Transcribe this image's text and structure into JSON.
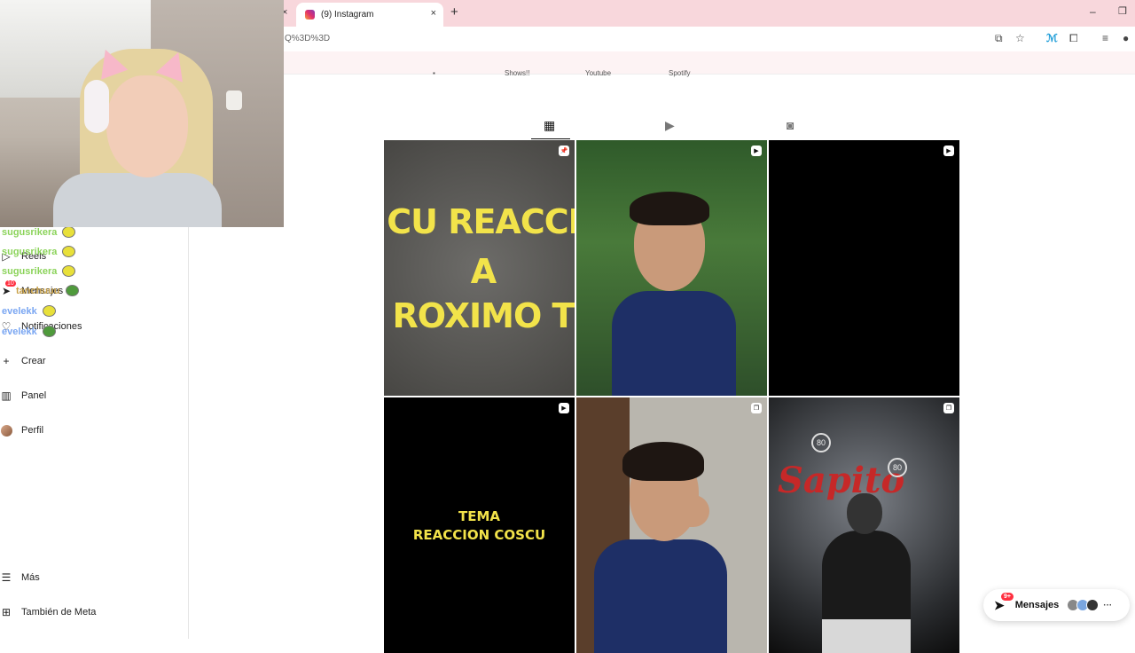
{
  "browser": {
    "tab_title": "(9) Instagram",
    "new_tab": "+",
    "tab_close": "×",
    "prev_tab_close": "×",
    "url_fragment": "Q%3D%3D",
    "minimize": "–",
    "restore": "❐"
  },
  "highlights_cut": [
    "Shows!!",
    "Youtube",
    "Spotify"
  ],
  "profile_tabs": [
    {
      "name": "posts",
      "icon": "grid-icon",
      "glyph": "▦",
      "active": true
    },
    {
      "name": "reels",
      "icon": "reels-icon",
      "glyph": "▶",
      "active": false
    },
    {
      "name": "tagged",
      "icon": "tagged-icon",
      "glyph": "◙",
      "active": false
    }
  ],
  "sidebar": {
    "items": [
      {
        "label": "Reels",
        "icon": "reels-icon"
      },
      {
        "label": "Mensajes",
        "icon": "messenger-icon"
      },
      {
        "label": "Notificaciones",
        "icon": "heart-icon"
      },
      {
        "label": "Crear",
        "icon": "plus-icon"
      },
      {
        "label": "Panel",
        "icon": "panel-icon"
      },
      {
        "label": "Perfil",
        "icon": "avatar"
      },
      {
        "label": "Más",
        "icon": "menu-icon"
      },
      {
        "label": "También de Meta",
        "icon": "meta-grid-icon"
      }
    ],
    "messages_badge": "10"
  },
  "chat": [
    {
      "user": "sugusrikera"
    },
    {
      "user": "sugusrikera"
    },
    {
      "user": "sugusrikera"
    },
    {
      "user": "tanchuuu"
    },
    {
      "user": "evelekk"
    },
    {
      "user": "evelekk"
    }
  ],
  "posts": [
    {
      "id": "p1",
      "text_lines": [
        "CU REACCI",
        "A",
        "ROXIMO T"
      ],
      "badge": "pin-icon"
    },
    {
      "id": "p2",
      "badge": "reel-icon"
    },
    {
      "id": "p3",
      "badge": "reel-icon"
    },
    {
      "id": "p4",
      "text_lines": [
        "TEMA",
        "REACCION COSCU"
      ],
      "badge": "reel-icon"
    },
    {
      "id": "p5",
      "badge": "carousel-icon"
    },
    {
      "id": "p6",
      "sign_text": "Sapito",
      "sign_numbers": [
        "80",
        "80"
      ],
      "badge": "carousel-icon"
    }
  ],
  "messages_pill": {
    "label": "Mensajes",
    "badge": "9+",
    "more": "···"
  },
  "colors": {
    "tabbar": "#f8d7dc",
    "accent_yellow": "#f2e34a",
    "notif_red": "#ff3040"
  }
}
